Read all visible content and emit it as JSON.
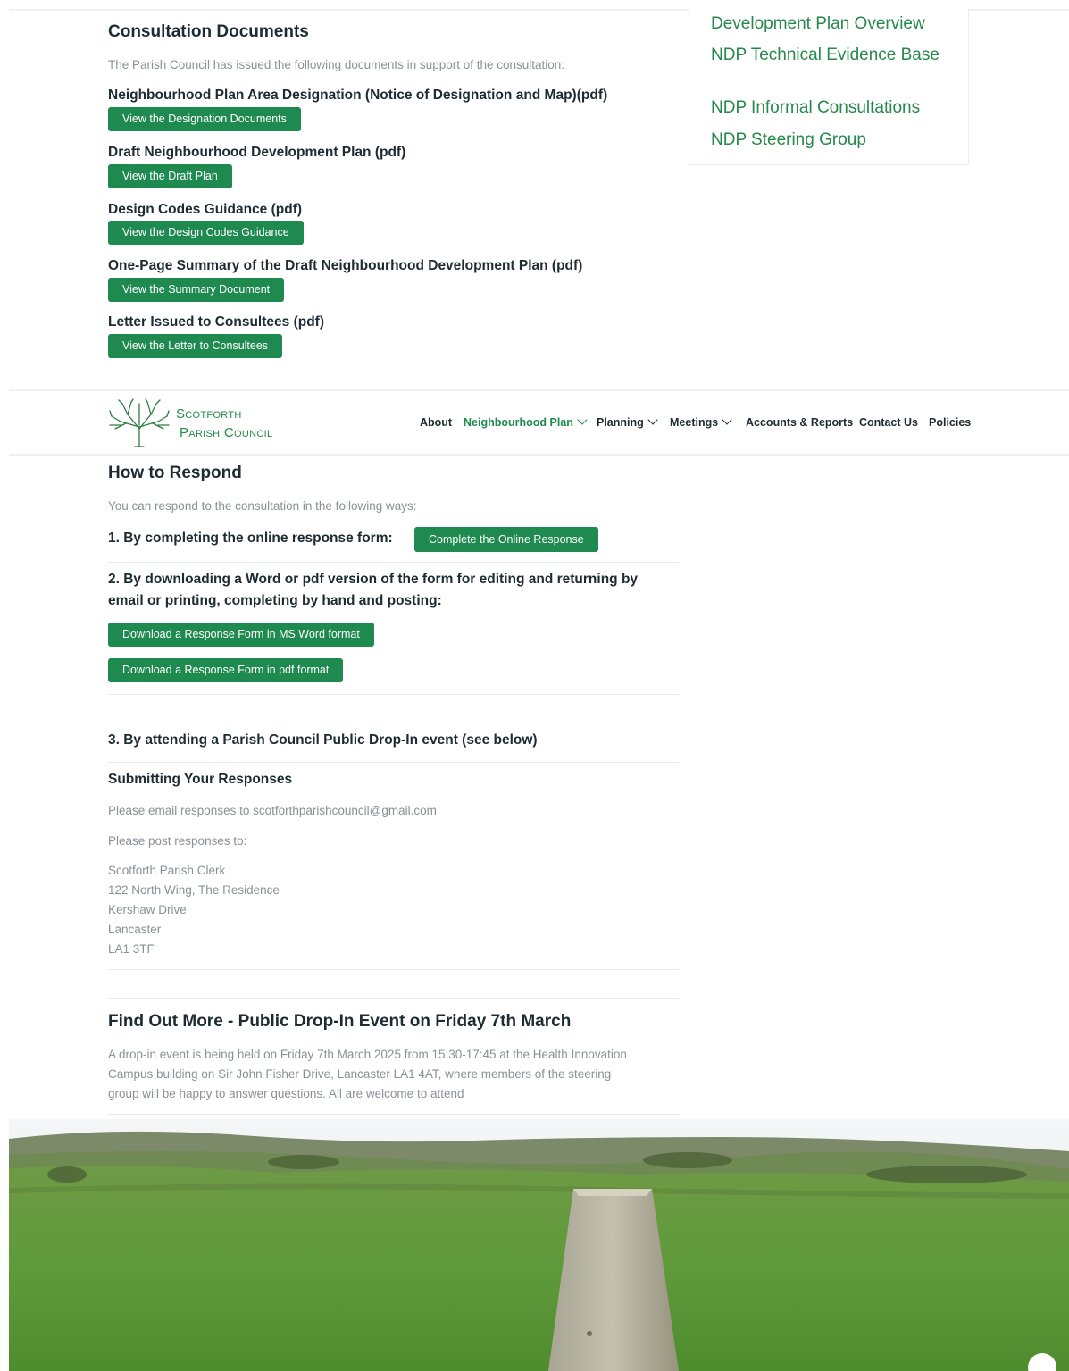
{
  "consultation": {
    "title": "Consultation Documents",
    "intro": "The Parish Council has issued the following documents in support of the consultation:",
    "docs": [
      {
        "heading": "Neighbourhood Plan Area Designation (Notice of Designation and Map)(pdf)",
        "button": "View the Designation Documents"
      },
      {
        "heading": "Draft Neighbourhood Development Plan (pdf)",
        "button": "View the Draft Plan"
      },
      {
        "heading": "Design Codes Guidance (pdf)",
        "button": "View the Design Codes Guidance"
      },
      {
        "heading": "One-Page Summary of the Draft Neighbourhood Development Plan (pdf)",
        "button": "View the Summary Document"
      },
      {
        "heading": "Letter Issued to Consultees (pdf)",
        "button": "View the Letter to Consultees"
      }
    ]
  },
  "sidebar": {
    "links": [
      "Development Plan Overview",
      "NDP Technical Evidence Base",
      "NDP Informal Consultations",
      "NDP Steering Group"
    ]
  },
  "header": {
    "logo_line1": "Scotforth",
    "logo_line2": "Parish Council",
    "nav": [
      "About",
      "Neighbourhood Plan",
      "Planning",
      "Meetings",
      "Accounts & Reports",
      "Contact Us",
      "Policies"
    ]
  },
  "respond": {
    "title": "How to Respond",
    "intro": "You can respond to the consultation in the following ways:",
    "option1": "1. By completing the online response form:",
    "option1_button": "Complete the Online Response",
    "option2_line1": "2. By downloading a Word or pdf version of the form for editing and returning by",
    "option2_line2": "email or printing, completing by hand and posting:",
    "word_button": "Download a Response Form in MS Word format",
    "pdf_button": "Download a Response Form in pdf format",
    "option3": "3. By attending a Parish Council Public Drop-In event (see below)"
  },
  "submitting": {
    "title": "Submitting Your Responses",
    "email": "Please email responses to scotforthparishcouncil@gmail.com",
    "post": "Please post responses to:",
    "address": [
      "Scotforth Parish Clerk",
      "122 North Wing, The Residence",
      "Kershaw Drive",
      "Lancaster",
      "LA1 3TF"
    ]
  },
  "event": {
    "title": "Find Out More - Public Drop-In Event on Friday 7th March",
    "lines": [
      "A drop-in event is being held on Friday 7th March 2025 from 15:30-17:45 at the Health Innovation",
      "Campus building on Sir John Fisher Drive, Lancaster LA1 4AT, where members of the steering",
      "group will be happy to answer questions.  All are welcome to attend"
    ]
  },
  "colors": {
    "brand_green": "#1e8a4f",
    "link_green": "#24894a"
  }
}
